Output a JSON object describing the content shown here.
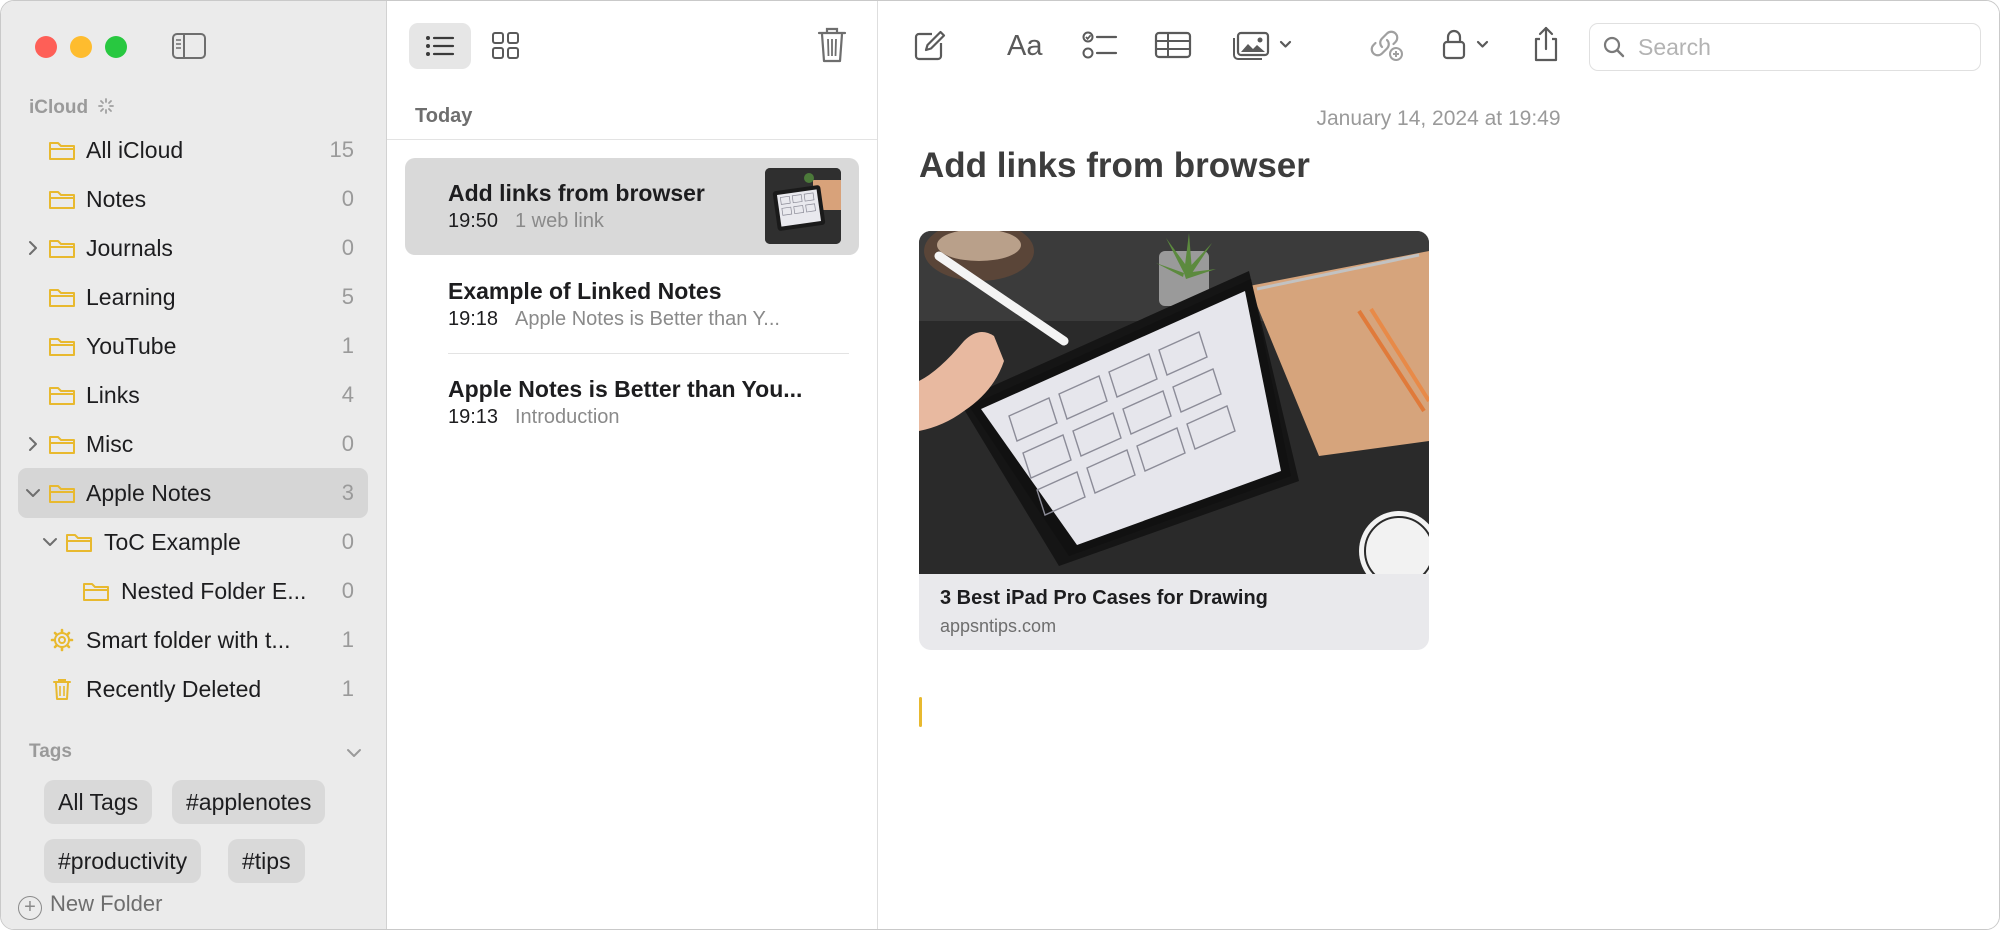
{
  "sidebar": {
    "section_label": "iCloud",
    "folders": [
      {
        "label": "All iCloud",
        "count": "15"
      },
      {
        "label": "Notes",
        "count": "0"
      },
      {
        "label": "Journals",
        "count": "0"
      },
      {
        "label": "Learning",
        "count": "5"
      },
      {
        "label": "YouTube",
        "count": "1"
      },
      {
        "label": "Links",
        "count": "4"
      },
      {
        "label": "Misc",
        "count": "0"
      },
      {
        "label": "Apple Notes",
        "count": "3"
      },
      {
        "label": "ToC Example",
        "count": "0"
      },
      {
        "label": "Nested Folder E...",
        "count": "0"
      },
      {
        "label": "Smart folder with t...",
        "count": "1"
      },
      {
        "label": "Recently Deleted",
        "count": "1"
      }
    ],
    "tags_label": "Tags",
    "tags": [
      "All Tags",
      "#applenotes",
      "#productivity",
      "#tips"
    ],
    "new_folder_label": "New Folder"
  },
  "list": {
    "section_label": "Today",
    "notes": [
      {
        "title": "Add links from browser",
        "time": "19:50",
        "preview": "1 web link"
      },
      {
        "title": "Example of Linked Notes",
        "time": "19:18",
        "preview": "Apple Notes is Better than Y..."
      },
      {
        "title": "Apple Notes is Better than You...",
        "time": "19:13",
        "preview": "Introduction"
      }
    ]
  },
  "editor": {
    "search_placeholder": "Search",
    "date": "January 14, 2024 at 19:49",
    "title": "Add links from browser",
    "link": {
      "title": "3 Best iPad Pro Cases for Drawing",
      "domain": "appsntips.com"
    }
  },
  "colors": {
    "accent": "#e8b92f",
    "folder": "#e8b92f",
    "close": "#fe5f57",
    "minimize": "#febc2e",
    "maximize": "#28c840"
  }
}
